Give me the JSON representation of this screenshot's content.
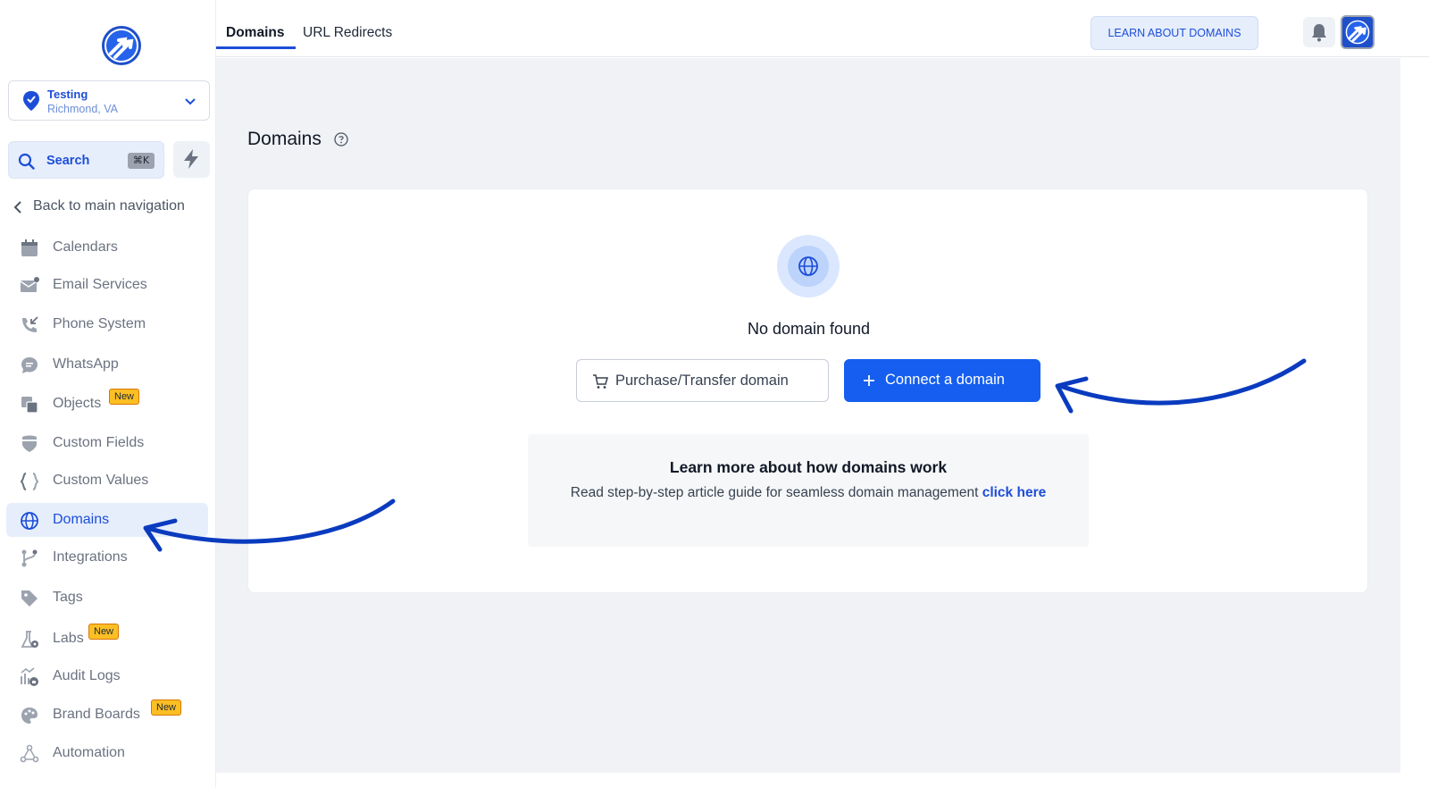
{
  "sidebar": {
    "location": {
      "name": "Testing",
      "sub": "Richmond, VA"
    },
    "search": {
      "label": "Search",
      "shortcut": "⌘K"
    },
    "back_label": "Back to main navigation",
    "items": [
      {
        "label": "Calendars",
        "icon": "calendar-icon"
      },
      {
        "label": "Email Services",
        "icon": "mail-icon"
      },
      {
        "label": "Phone System",
        "icon": "phone-icon"
      },
      {
        "label": "WhatsApp",
        "icon": "chat-icon"
      },
      {
        "label": "Objects",
        "icon": "objects-icon",
        "badge": "New"
      },
      {
        "label": "Custom Fields",
        "icon": "shield-icon"
      },
      {
        "label": "Custom Values",
        "icon": "braces-icon"
      },
      {
        "label": "Domains",
        "icon": "globe-icon",
        "active": true
      },
      {
        "label": "Integrations",
        "icon": "branch-icon"
      },
      {
        "label": "Tags",
        "icon": "tag-icon"
      },
      {
        "label": "Labs",
        "icon": "flask-icon",
        "badge": "New"
      },
      {
        "label": "Audit Logs",
        "icon": "audit-icon"
      },
      {
        "label": "Brand Boards",
        "icon": "palette-icon",
        "badge": "New"
      },
      {
        "label": "Automation",
        "icon": "network-icon"
      }
    ]
  },
  "topbar": {
    "tabs": [
      {
        "label": "Domains",
        "active": true
      },
      {
        "label": "URL Redirects",
        "active": false
      }
    ],
    "learn_button": "LEARN ABOUT DOMAINS"
  },
  "main": {
    "title": "Domains",
    "empty_state": {
      "title": "No domain found",
      "purchase_button": "Purchase/Transfer domain",
      "connect_button": "Connect a domain"
    },
    "info": {
      "heading": "Learn more about how domains work",
      "body": "Read step-by-step article guide for seamless domain management ",
      "link": "click here"
    }
  },
  "colors": {
    "accent": "#155eef",
    "brand_blue": "#1d4ed8",
    "badge": "#fbbf24",
    "annotation_arrow": "#0a3bbf"
  }
}
